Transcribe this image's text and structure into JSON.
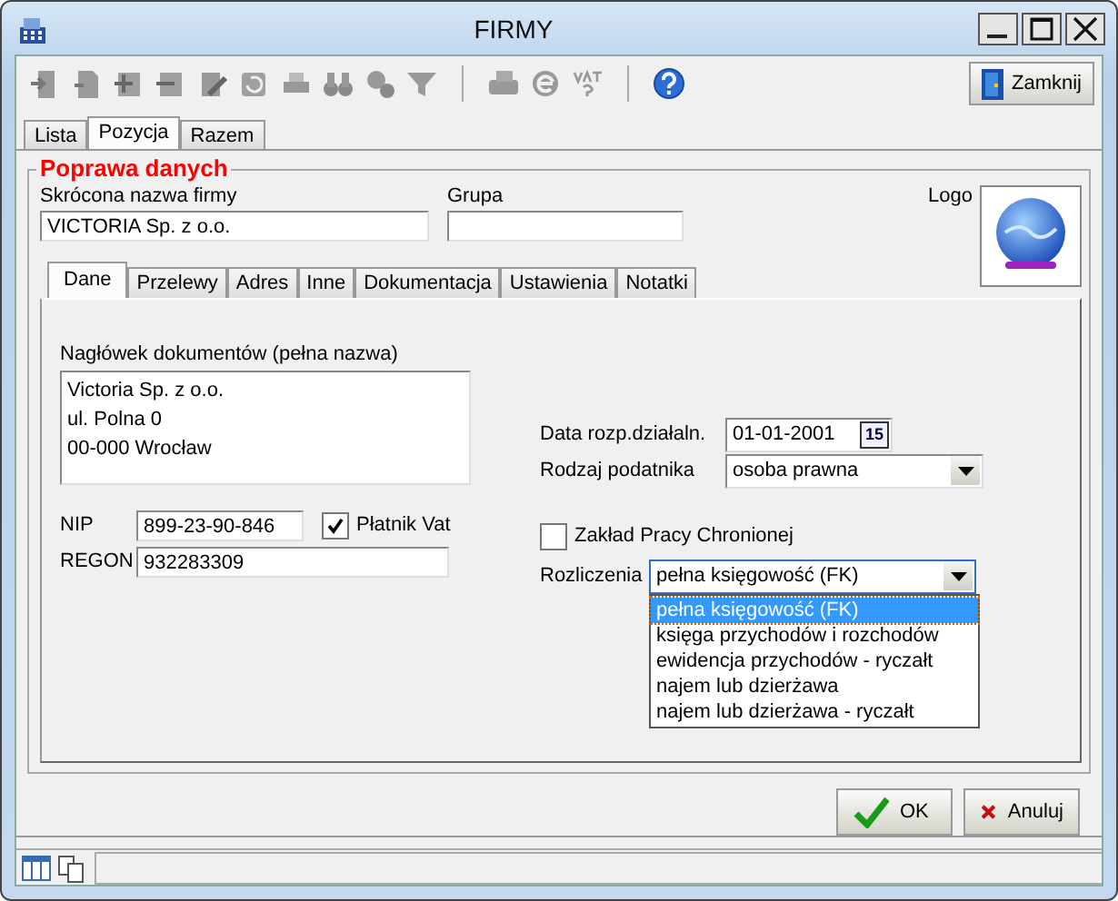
{
  "window": {
    "title": "FIRMY"
  },
  "toolbar": {
    "close_button": "Zamknij"
  },
  "tabs": [
    {
      "label": "Lista",
      "selected": false
    },
    {
      "label": "Pozycja",
      "selected": true
    },
    {
      "label": "Razem",
      "selected": false
    }
  ],
  "group": {
    "title": "Poprawa danych",
    "short_name": {
      "label": "Skrócona nazwa firmy",
      "value": "VICTORIA Sp. z o.o."
    },
    "group_field": {
      "label": "Grupa"
    },
    "logo": {
      "label": "Logo"
    },
    "inner_tabs": [
      {
        "label": "Dane",
        "selected": true
      },
      {
        "label": "Przelewy",
        "selected": false
      },
      {
        "label": "Adres",
        "selected": false
      },
      {
        "label": "Inne",
        "selected": false
      },
      {
        "label": "Dokumentacja",
        "selected": false
      },
      {
        "label": "Ustawienia",
        "selected": false
      },
      {
        "label": "Notatki",
        "selected": false
      }
    ],
    "header": {
      "label": "Nagłówek dokumentów (pełna nazwa)",
      "lines": [
        "Victoria Sp. z o.o.",
        "ul. Polna 0",
        "00-000 Wrocław"
      ]
    },
    "nip": {
      "label": "NIP",
      "value": "899-23-90-846"
    },
    "vat_payer": {
      "label": "Płatnik Vat",
      "checked": true
    },
    "regon": {
      "label": "REGON",
      "value": "932283309"
    },
    "start_date": {
      "label": "Data rozp.działaln.",
      "value": "01-01-2001",
      "calendar_button": "15"
    },
    "taxpayer_type": {
      "label": "Rodzaj podatnika",
      "value": "osoba prawna"
    },
    "protected_workplace": {
      "label": "Zakład Pracy Chronionej",
      "checked": false
    },
    "settlement": {
      "label": "Rozliczenia",
      "value": "pełna księgowość (FK)",
      "expanded": true,
      "options": [
        {
          "label": "pełna księgowość (FK)",
          "selected": true
        },
        {
          "label": "księga przychodów i rozchodów",
          "selected": false
        },
        {
          "label": "ewidencja przychodów - ryczałt",
          "selected": false
        },
        {
          "label": "najem lub dzierżawa",
          "selected": false
        },
        {
          "label": "najem lub dzierżawa - ryczałt",
          "selected": false
        }
      ]
    }
  },
  "buttons": [
    {
      "label": "OK",
      "kind": "ok"
    },
    {
      "label": "Anuluj",
      "kind": "cancel"
    }
  ]
}
